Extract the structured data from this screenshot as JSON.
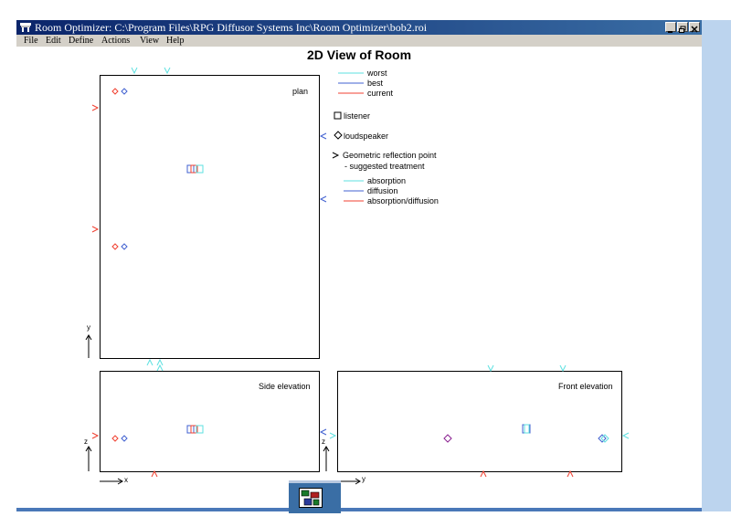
{
  "window": {
    "title": "Room Optimizer: C:\\Program Files\\RPG Diffusor Systems Inc\\Room Optimizer\\bob2.roi"
  },
  "menu": {
    "items": [
      {
        "label": "File"
      },
      {
        "label": "Edit"
      },
      {
        "label": "Define"
      },
      {
        "label": "Actions"
      },
      {
        "label": "View"
      },
      {
        "label": "Help"
      }
    ]
  },
  "view": {
    "title": "2D View of Room",
    "plan_label": "plan",
    "side_label": "Side elevation",
    "front_label": "Front elevation"
  },
  "legend": {
    "worst": "worst",
    "best": "best",
    "current": "current",
    "listener": "listener",
    "loudspeaker": "loudspeaker",
    "reflection": "Geometric reflection point",
    "suggested": "- suggested treatment",
    "absorption": "absorption",
    "diffusion": "diffusion",
    "absorption_diffusion": "absorption/diffusion"
  },
  "axes": {
    "plan_y": "y",
    "side_z": "z",
    "side_x": "x",
    "front_z": "z",
    "front_y": "y"
  },
  "colors": {
    "worst": "#5ee0e0",
    "best": "#4060d0",
    "current": "#f04030",
    "title_bar": "#0a246a",
    "menu_bg": "#d4d0c8",
    "side_strip": "#bcd4ee"
  },
  "icons": {
    "app": "room-optimizer-app-icon",
    "panel": "room-layout-icon"
  }
}
